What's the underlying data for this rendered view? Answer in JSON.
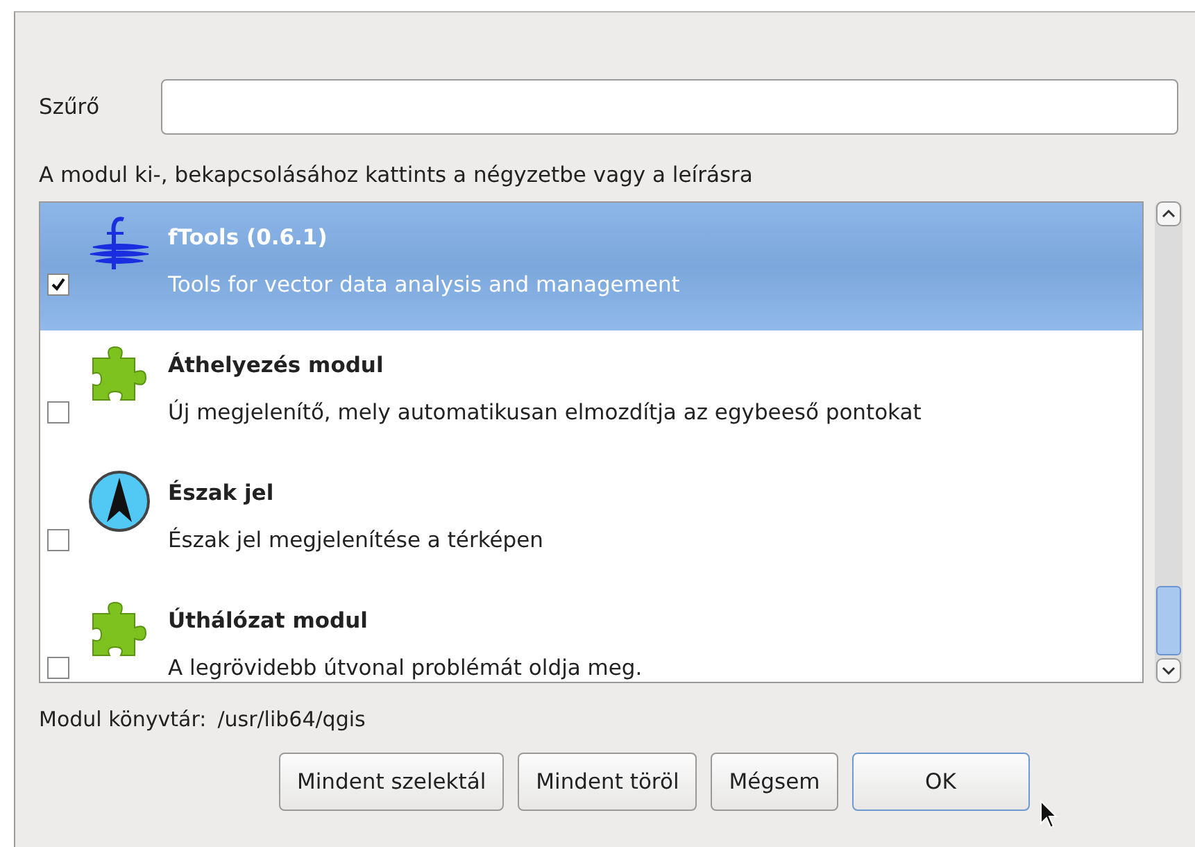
{
  "filter": {
    "label": "Szűrő"
  },
  "hint": "A modul ki-, bekapcsolásához kattints a négyzetbe vagy a leírásra",
  "plugins": [
    {
      "kind": "ftools",
      "title": "fTools (0.6.1)",
      "description": "Tools for vector data analysis and management",
      "checked": true,
      "selected": true
    },
    {
      "kind": "puzzle",
      "title": "Áthelyezés modul",
      "description": "Új megjelenítő, mely automatikusan elmozdítja az egybeeső pontokat",
      "checked": false,
      "selected": false
    },
    {
      "kind": "north",
      "title": "Észak jel",
      "description": "Észak jel megjelenítése a térképen",
      "checked": false,
      "selected": false
    },
    {
      "kind": "puzzle",
      "title": "Úthálózat modul",
      "description": "A legrövidebb útvonal problémát oldja meg.",
      "checked": false,
      "selected": false
    }
  ],
  "library": {
    "label": "Modul könyvtár:",
    "path": "/usr/lib64/qgis"
  },
  "buttons": [
    {
      "label": "Mindent szelektál",
      "focused": false
    },
    {
      "label": "Mindent töröl",
      "focused": false
    },
    {
      "label": "Mégsem",
      "focused": false
    },
    {
      "label": "OK",
      "focused": true
    }
  ]
}
